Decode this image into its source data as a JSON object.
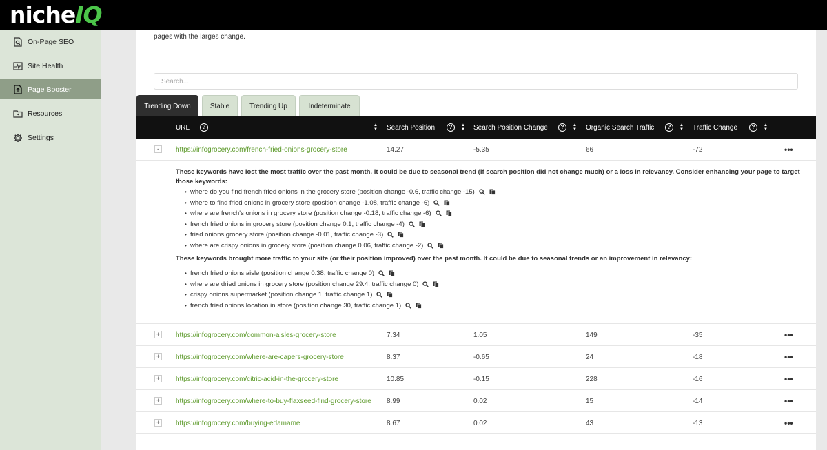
{
  "app": {
    "logo_main": "niche",
    "logo_accent": "IQ"
  },
  "sidebar": {
    "items": [
      {
        "label": "On-Page SEO",
        "icon": "search-page-icon"
      },
      {
        "label": "Site Health",
        "icon": "pulse-icon"
      },
      {
        "label": "Page Booster",
        "icon": "upload-page-icon",
        "active": true
      },
      {
        "label": "Resources",
        "icon": "folder-icon"
      },
      {
        "label": "Settings",
        "icon": "gear-icon"
      }
    ]
  },
  "main": {
    "intro": "pages with the larges change.",
    "search_placeholder": "Search...",
    "tabs": [
      {
        "label": "Trending Down",
        "active": true
      },
      {
        "label": "Stable"
      },
      {
        "label": "Trending Up"
      },
      {
        "label": "Indeterminate"
      }
    ],
    "columns": [
      "URL",
      "Search Position",
      "Search Position Change",
      "Organic Search Traffic",
      "Traffic Change"
    ],
    "rows": [
      {
        "toggle": "-",
        "url": "https://infogrocery.com/french-fried-onions-grocery-store",
        "position": "14.27",
        "position_change": "-5.35",
        "traffic": "66",
        "traffic_change": "-72",
        "more": "•••"
      },
      {
        "toggle": "+",
        "url": "https://infogrocery.com/common-aisles-grocery-store",
        "position": "7.34",
        "position_change": "1.05",
        "traffic": "149",
        "traffic_change": "-35",
        "more": "•••"
      },
      {
        "toggle": "+",
        "url": "https://infogrocery.com/where-are-capers-grocery-store",
        "position": "8.37",
        "position_change": "-0.65",
        "traffic": "24",
        "traffic_change": "-18",
        "more": "•••"
      },
      {
        "toggle": "+",
        "url": "https://infogrocery.com/citric-acid-in-the-grocery-store",
        "position": "10.85",
        "position_change": "-0.15",
        "traffic": "228",
        "traffic_change": "-16",
        "more": "•••"
      },
      {
        "toggle": "+",
        "url": "https://infogrocery.com/where-to-buy-flaxseed-find-grocery-store",
        "position": "8.99",
        "position_change": "0.02",
        "traffic": "15",
        "traffic_change": "-14",
        "more": "•••"
      },
      {
        "toggle": "+",
        "url": "https://infogrocery.com/buying-edamame",
        "position": "8.67",
        "position_change": "0.02",
        "traffic": "43",
        "traffic_change": "-13",
        "more": "•••"
      }
    ],
    "detail": {
      "lost_header": "These keywords have lost the most traffic over the past month. It could be due to seasonal trend (if search position did not change much) or a loss in relevancy. Consider enhancing your page to target those keywords:",
      "lost": [
        "where do you find french fried onions in the grocery store (position change -0.6, traffic change -15)",
        "where to find fried onions in grocery store (position change -1.08, traffic change -6)",
        "where are french's onions in grocery store (position change -0.18, traffic change -6)",
        "french fried onions in grocery store (position change 0.1, traffic change -4)",
        "fried onions grocery store (position change -0.01, traffic change -3)",
        "where are crispy onions in grocery store (position change 0.06, traffic change -2)"
      ],
      "gained_header": "These keywords brought more traffic to your site (or their position improved) over the past month. It could be due to seasonal trends or an improvement in relevancy:",
      "gained": [
        "french fried onions aisle (position change 0.38, traffic change 0)",
        "where are dried onions in grocery store (position change 29.4, traffic change 0)",
        "crispy onions supermarket (position change 1, traffic change 1)",
        "french fried onions location in store (position change 30, traffic change 1)"
      ]
    }
  }
}
